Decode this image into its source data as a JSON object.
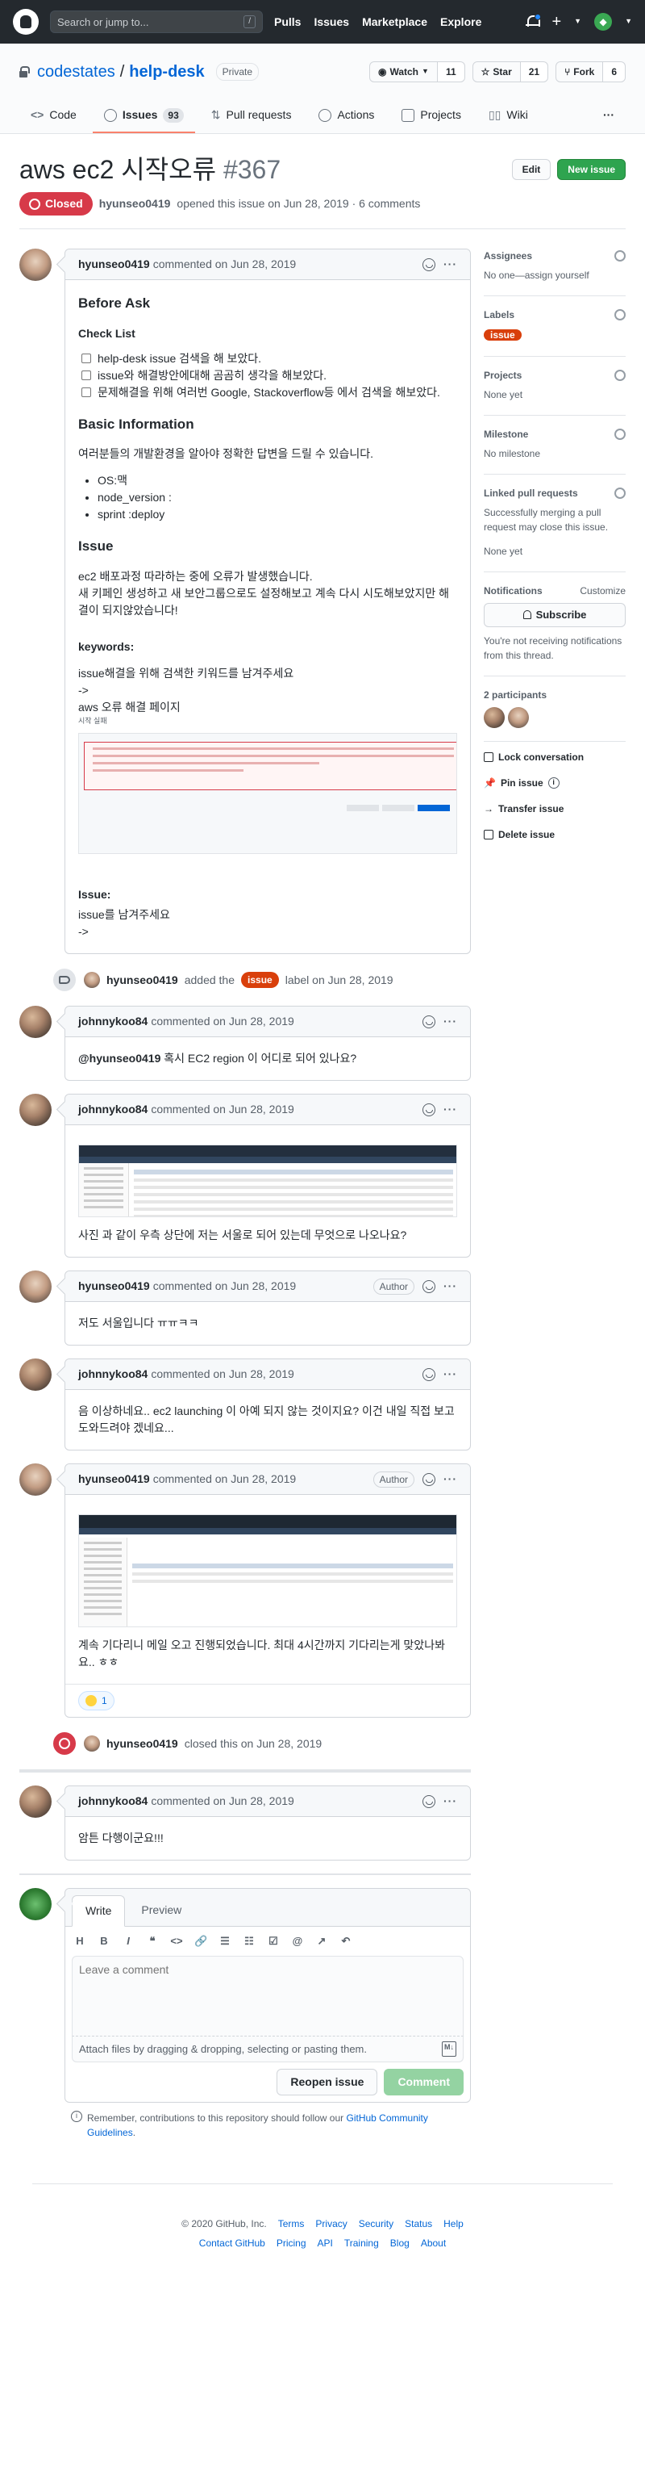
{
  "topbar": {
    "search_placeholder": "Search or jump to...",
    "slash_hint": "/",
    "nav": [
      "Pulls",
      "Issues",
      "Marketplace",
      "Explore"
    ]
  },
  "repo": {
    "owner": "codestates",
    "separator": "/",
    "name": "help-desk",
    "visibility": "Private",
    "watch_label": "Watch",
    "watch_count": "11",
    "star_label": "Star",
    "star_count": "21",
    "fork_label": "Fork",
    "fork_count": "6",
    "tabs": [
      {
        "label": "Code",
        "counter": ""
      },
      {
        "label": "Issues",
        "counter": "93"
      },
      {
        "label": "Pull requests",
        "counter": ""
      },
      {
        "label": "Actions",
        "counter": ""
      },
      {
        "label": "Projects",
        "counter": ""
      },
      {
        "label": "Wiki",
        "counter": ""
      }
    ],
    "more": "···"
  },
  "issue": {
    "title": "aws ec2 시작오류",
    "number": "#367",
    "edit_label": "Edit",
    "new_issue_label": "New issue",
    "state": "Closed",
    "author": "hyunseo0419",
    "opened_text": "opened this issue on Jun 28, 2019 · 6 comments"
  },
  "colors": {
    "accent": "#2ea44f",
    "closed": "#d73a49",
    "label_issue": "#d93f0b",
    "tab_underline": "#f9826c"
  },
  "comments": [
    {
      "author": "hyunseo0419",
      "verb": "commented on Jun 28, 2019",
      "h_before": "Before Ask",
      "h_checklist": "Check List",
      "tasks": [
        "help-desk issue 검색을 해 보았다.",
        "issue와 해결방안에대해 곰곰히 생각을 해보았다.",
        "문제해결을 위해 여러번 Google, Stackoverflow등 에서 검색을 해보았다."
      ],
      "h_basic": "Basic Information",
      "basic_intro": "여러분들의 개발환경을 알아야 정확한 답변을 드릴 수 있습니다.",
      "env": [
        "OS:맥",
        "node_version :",
        "sprint :deploy"
      ],
      "h_issue": "Issue",
      "issue_p1": "ec2 배포과정 따라하는 중에 오류가 발생했습니다.",
      "issue_p2": "새 키페인 생성하고 새 보안그룹으로도 설정해보고 계속 다시 시도해보았지만 해결이 되지않았습니다!",
      "keywords_h": "keywords:",
      "kw1": "issue해결을 위해 검색한 키워드를 남겨주세요",
      "kw_arrow": "->",
      "kw2": "aws 오류 해결 페이지",
      "caption": "시작 실패",
      "issue2_h": "Issue:",
      "issue2_p": "issue를 남겨주세요",
      "issue2_arrow": "->"
    }
  ],
  "label_event": {
    "user": "hyunseo0419",
    "before": "added the",
    "label": "issue",
    "after": "label on Jun 28, 2019"
  },
  "c2": {
    "author": "johnnykoo84",
    "verb": "commented on Jun 28, 2019",
    "mention": "@hyunseo0419",
    "text": "혹시 EC2 region 이 어디로 되어 있나요?"
  },
  "c3": {
    "author": "johnnykoo84",
    "verb": "commented on Jun 28, 2019",
    "text": "사진 과 같이 우측 상단에 저는 서울로 되어 있는데 무엇으로 나오나요?"
  },
  "c4": {
    "author": "hyunseo0419",
    "verb": "commented on Jun 28, 2019",
    "badge": "Author",
    "text": "저도 서울입니다 ㅠㅠㅋㅋ"
  },
  "c5": {
    "author": "johnnykoo84",
    "verb": "commented on Jun 28, 2019",
    "text": "음 이상하네요.. ec2 launching 이 아예 되지 않는 것이지요? 이건 내일 직접 보고 도와드려야 겠네요..."
  },
  "c6": {
    "author": "hyunseo0419",
    "verb": "commented on Jun 28, 2019",
    "badge": "Author",
    "text": "계속 기다리니 메일 오고 진행되었습니다. 최대 4시간까지 기다리는게 맞았나봐요.. ㅎㅎ",
    "reaction_count": "1"
  },
  "closed_event": {
    "user": "hyunseo0419",
    "text": "closed this on Jun 28, 2019"
  },
  "c7": {
    "author": "johnnykoo84",
    "verb": "commented on Jun 28, 2019",
    "text": "암튼 다행이군요!!!"
  },
  "sidebar": {
    "assignees_h": "Assignees",
    "assignees_v": "No one—assign yourself",
    "labels_h": "Labels",
    "label": "issue",
    "projects_h": "Projects",
    "projects_v": "None yet",
    "milestone_h": "Milestone",
    "milestone_v": "No milestone",
    "linked_h": "Linked pull requests",
    "linked_desc": "Successfully merging a pull request may close this issue.",
    "linked_v": "None yet",
    "notif_h": "Notifications",
    "customize": "Customize",
    "subscribe": "Subscribe",
    "notif_desc": "You're not receiving notifications from this thread.",
    "participants_h": "2 participants",
    "lock": "Lock conversation",
    "pin": "Pin issue",
    "transfer": "Transfer issue",
    "delete": "Delete issue"
  },
  "new_comment": {
    "write": "Write",
    "preview": "Preview",
    "toolbar": [
      "H",
      "B",
      "I",
      "❝",
      "<>",
      "🔗",
      "☰",
      "☷",
      "☑",
      "@",
      "↗",
      "↶"
    ],
    "placeholder": "Leave a comment",
    "attach": "Attach files by dragging & dropping, selecting or pasting them.",
    "md": "M↓",
    "reopen": "Reopen issue",
    "comment": "Comment",
    "remember": "Remember, contributions to this repository should follow our",
    "guidelines": "GitHub Community Guidelines",
    "period": "."
  },
  "footer": {
    "copy": "© 2020 GitHub, Inc.",
    "links1": [
      "Terms",
      "Privacy",
      "Security",
      "Status",
      "Help"
    ],
    "links2": [
      "Contact GitHub",
      "Pricing",
      "API",
      "Training",
      "Blog",
      "About"
    ]
  }
}
